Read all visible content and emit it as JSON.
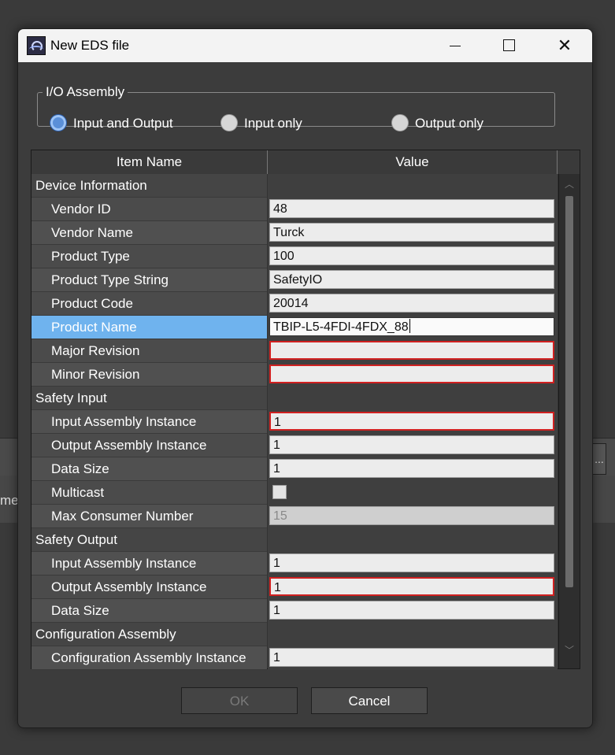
{
  "background": {
    "fragment_text": "me",
    "fragment_button": "..."
  },
  "window": {
    "title": "New EDS file",
    "minimize_icon": "minimize-icon",
    "maximize_icon": "maximize-icon",
    "close_icon": "close-icon"
  },
  "io_assembly": {
    "legend": "I/O Assembly",
    "options": [
      {
        "label": "Input and Output",
        "selected": true
      },
      {
        "label": "Input only",
        "selected": false
      },
      {
        "label": "Output only",
        "selected": false
      }
    ]
  },
  "grid": {
    "headers": {
      "name": "Item Name",
      "value": "Value"
    },
    "rows": [
      {
        "name": "Device Information",
        "section": true
      },
      {
        "name": "Vendor ID",
        "value": "48"
      },
      {
        "name": "Vendor Name",
        "value": "Turck"
      },
      {
        "name": "Product Type",
        "value": "100"
      },
      {
        "name": "Product Type String",
        "value": "SafetyIO"
      },
      {
        "name": "Product Code",
        "value": "20014"
      },
      {
        "name": "Product Name",
        "value": "TBIP-L5-4FDI-4FDX_88",
        "selected": true,
        "editing": true
      },
      {
        "name": "Major Revision",
        "value": "",
        "error": true
      },
      {
        "name": "Minor Revision",
        "value": "",
        "error": true
      },
      {
        "name": "Safety Input",
        "section": true
      },
      {
        "name": "Input Assembly Instance",
        "value": "1",
        "error": true
      },
      {
        "name": "Output Assembly Instance",
        "value": "1"
      },
      {
        "name": "Data Size",
        "value": "1"
      },
      {
        "name": "Multicast",
        "checkbox": true,
        "checked": false
      },
      {
        "name": "Max Consumer Number",
        "value": "15",
        "disabled": true
      },
      {
        "name": "Safety Output",
        "section": true
      },
      {
        "name": "Input Assembly Instance",
        "value": "1"
      },
      {
        "name": "Output Assembly Instance",
        "value": "1",
        "error": true
      },
      {
        "name": "Data Size",
        "value": "1"
      },
      {
        "name": "Configuration Assembly",
        "section": true
      },
      {
        "name": "Configuration Assembly Instance",
        "value": "1"
      }
    ]
  },
  "buttons": {
    "ok": "OK",
    "cancel": "Cancel",
    "ok_enabled": false
  }
}
